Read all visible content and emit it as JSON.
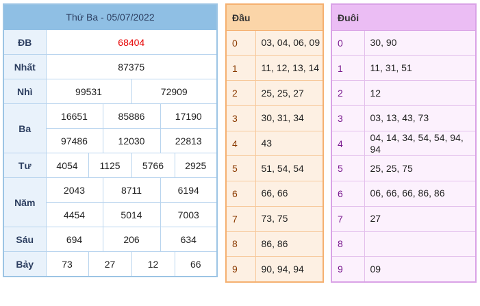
{
  "results": {
    "title": "Thứ Ba - 05/07/2022",
    "rows": {
      "db": {
        "label": "ĐB",
        "values": [
          "68404"
        ]
      },
      "nhat": {
        "label": "Nhất",
        "values": [
          "87375"
        ]
      },
      "nhi": {
        "label": "Nhì",
        "values": [
          "99531",
          "72909"
        ]
      },
      "ba": {
        "label": "Ba",
        "values": [
          "16651",
          "85886",
          "17190",
          "97486",
          "12030",
          "22813"
        ]
      },
      "tu": {
        "label": "Tư",
        "values": [
          "4054",
          "1125",
          "5766",
          "2925"
        ]
      },
      "nam": {
        "label": "Năm",
        "values": [
          "2043",
          "8711",
          "6194",
          "4454",
          "5014",
          "7003"
        ]
      },
      "sau": {
        "label": "Sáu",
        "values": [
          "694",
          "206",
          "634"
        ]
      },
      "bay": {
        "label": "Bảy",
        "values": [
          "73",
          "27",
          "12",
          "66"
        ]
      }
    }
  },
  "head": {
    "title": "Đầu",
    "rows": [
      {
        "k": "0",
        "v": "03, 04, 06, 09"
      },
      {
        "k": "1",
        "v": "11, 12, 13, 14"
      },
      {
        "k": "2",
        "v": "25, 25, 27"
      },
      {
        "k": "3",
        "v": "30, 31, 34"
      },
      {
        "k": "4",
        "v": "43"
      },
      {
        "k": "5",
        "v": "51, 54, 54"
      },
      {
        "k": "6",
        "v": "66, 66"
      },
      {
        "k": "7",
        "v": "73, 75"
      },
      {
        "k": "8",
        "v": "86, 86"
      },
      {
        "k": "9",
        "v": "90, 94, 94"
      }
    ]
  },
  "tail": {
    "title": "Đuôi",
    "rows": [
      {
        "k": "0",
        "v": "30, 90"
      },
      {
        "k": "1",
        "v": "11, 31, 51"
      },
      {
        "k": "2",
        "v": "12"
      },
      {
        "k": "3",
        "v": "03, 13, 43, 73"
      },
      {
        "k": "4",
        "v": "04, 14, 34, 54, 54, 94, 94"
      },
      {
        "k": "5",
        "v": "25, 25, 75"
      },
      {
        "k": "6",
        "v": "06, 66, 66, 86, 86"
      },
      {
        "k": "7",
        "v": "27"
      },
      {
        "k": "8",
        "v": ""
      },
      {
        "k": "9",
        "v": "09"
      }
    ]
  }
}
